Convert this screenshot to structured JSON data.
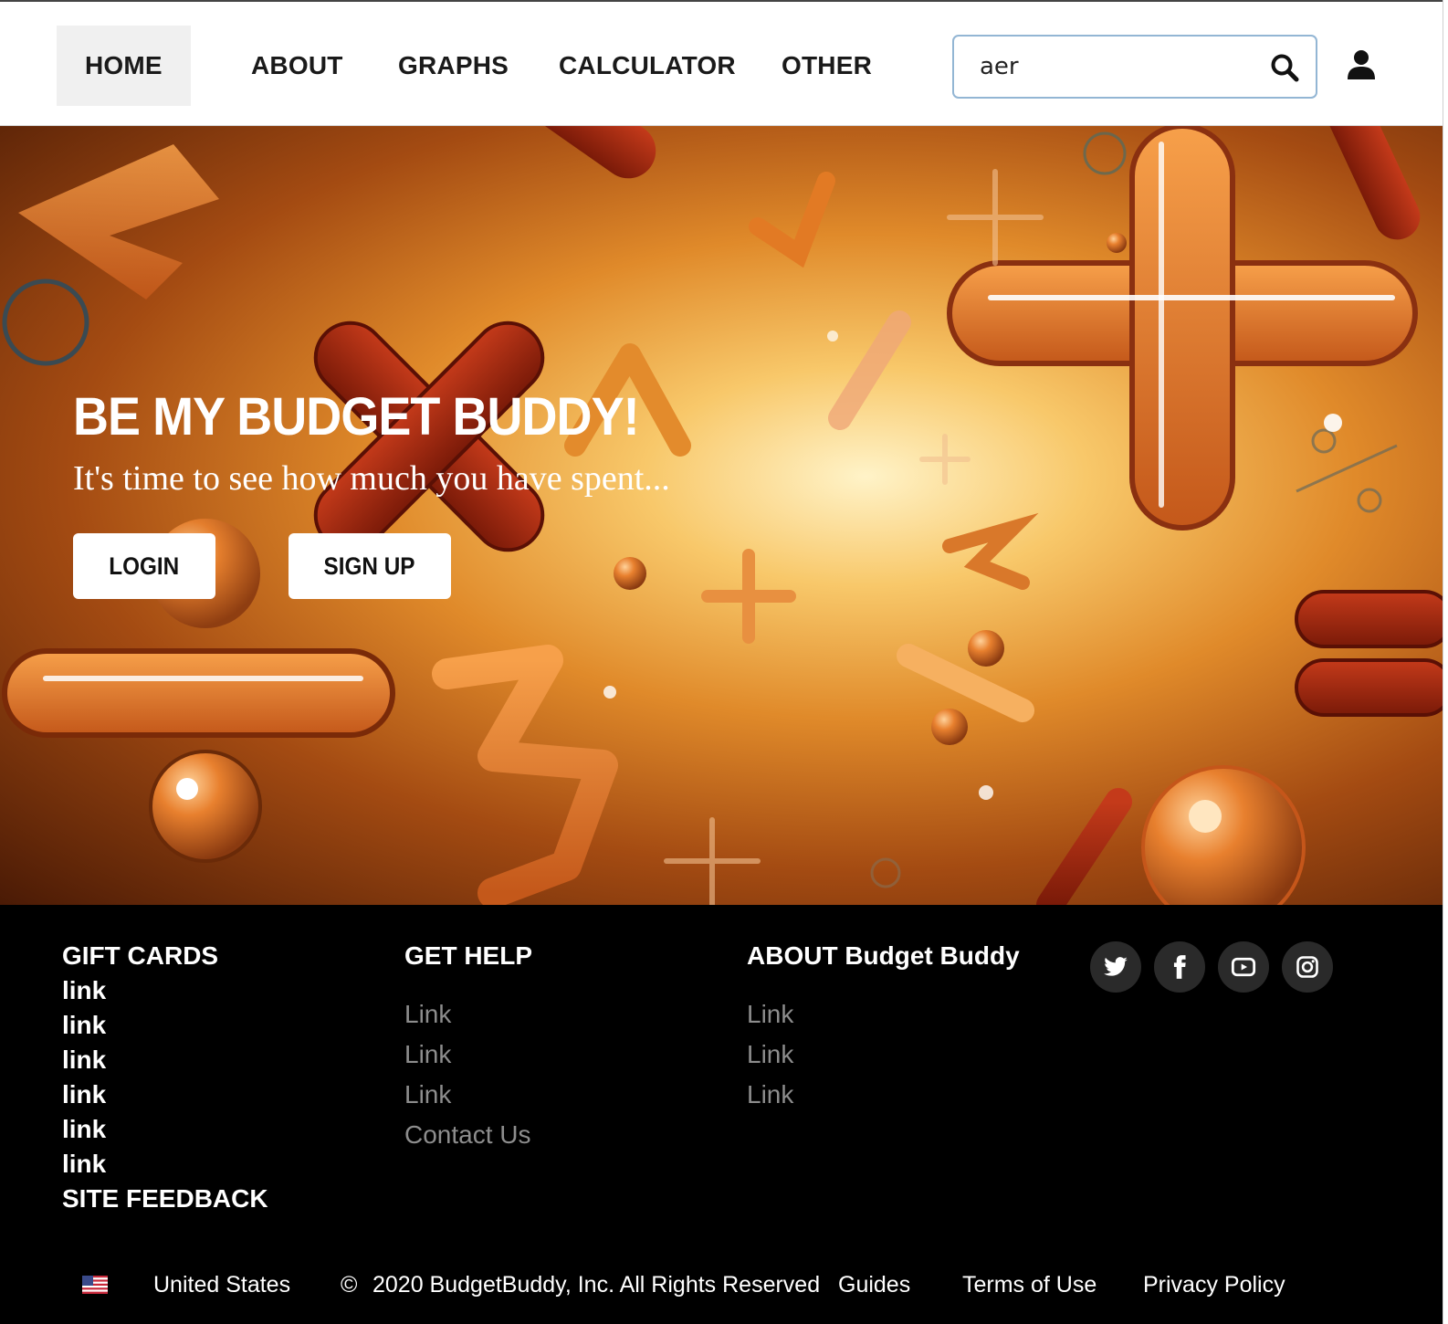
{
  "nav": {
    "items": [
      {
        "label": "HOME",
        "active": true
      },
      {
        "label": "ABOUT"
      },
      {
        "label": "GRAPHS"
      },
      {
        "label": "CALCULATOR"
      },
      {
        "label": "OTHER"
      }
    ],
    "search_value": "aer",
    "search_icon": "search-icon",
    "user_icon": "user-icon",
    "search_border_color": "#93b6d4"
  },
  "hero": {
    "title": "BE MY BUDGET BUDDY!",
    "subtitle": "It's time to see how much you have spent...",
    "login_label": "LOGIN",
    "signup_label": "SIGN UP"
  },
  "footer": {
    "gift_cards": {
      "title": "GIFT CARDS",
      "links": [
        "link",
        "link",
        "link",
        "link",
        "link",
        "link"
      ],
      "feedback": "SITE FEEDBACK"
    },
    "get_help": {
      "title": "GET HELP",
      "links": [
        "Link",
        "Link",
        "Link",
        "Contact Us"
      ]
    },
    "about": {
      "title": "ABOUT Budget Buddy",
      "links": [
        "Link",
        "Link",
        "Link"
      ]
    },
    "social": [
      "twitter-icon",
      "facebook-icon",
      "youtube-icon",
      "instagram-icon"
    ],
    "bottom": {
      "country": "United States",
      "copyright_symbol": "©",
      "copyright": "2020 BudgetBuddy, Inc. All Rights Reserved",
      "guides": "Guides",
      "terms": "Terms of Use",
      "privacy": "Privacy Policy"
    }
  },
  "colors": {
    "footer_bg": "#000000",
    "footer_muted_link": "#8d8d8d",
    "social_bg": "#2a2a2a",
    "hero_accent": "#e5782a"
  }
}
